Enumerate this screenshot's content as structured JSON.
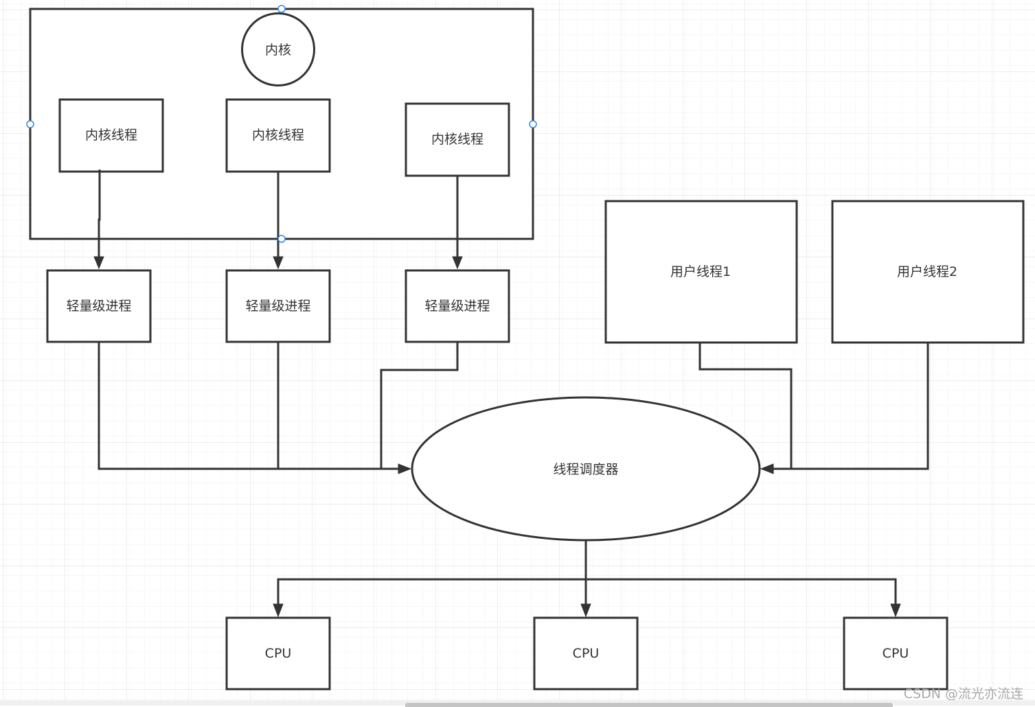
{
  "diagram": {
    "kernel_container": {
      "label": ""
    },
    "kernel": {
      "label": "内核"
    },
    "kernel_threads": [
      {
        "label": "内核线程"
      },
      {
        "label": "内核线程"
      },
      {
        "label": "内核线程"
      }
    ],
    "lightweight_processes": [
      {
        "label": "轻量级进程"
      },
      {
        "label": "轻量级进程"
      },
      {
        "label": "轻量级进程"
      }
    ],
    "user_threads": [
      {
        "label": "用户线程1"
      },
      {
        "label": "用户线程2"
      }
    ],
    "scheduler": {
      "label": "线程调度器"
    },
    "cpus": [
      {
        "label": "CPU"
      },
      {
        "label": "CPU"
      },
      {
        "label": "CPU"
      }
    ],
    "edges": [
      {
        "from": "内核线程 1",
        "to": "轻量级进程 1"
      },
      {
        "from": "内核线程 2",
        "to": "轻量级进程 2"
      },
      {
        "from": "内核线程 3",
        "to": "轻量级进程 3"
      },
      {
        "from": "轻量级进程 1",
        "to": "线程调度器"
      },
      {
        "from": "轻量级进程 2",
        "to": "线程调度器"
      },
      {
        "from": "轻量级进程 3",
        "to": "线程调度器"
      },
      {
        "from": "用户线程1",
        "to": "线程调度器"
      },
      {
        "from": "用户线程2",
        "to": "线程调度器"
      },
      {
        "from": "线程调度器",
        "to": "CPU 1"
      },
      {
        "from": "线程调度器",
        "to": "CPU 2"
      },
      {
        "from": "线程调度器",
        "to": "CPU 3"
      }
    ]
  },
  "colors": {
    "stroke": "#333333",
    "selection_handle": "#2a88e6",
    "grid_minor": "#f3f3f3",
    "grid_major": "#e8e8e8"
  },
  "watermark": "CSDN @流光亦流连"
}
